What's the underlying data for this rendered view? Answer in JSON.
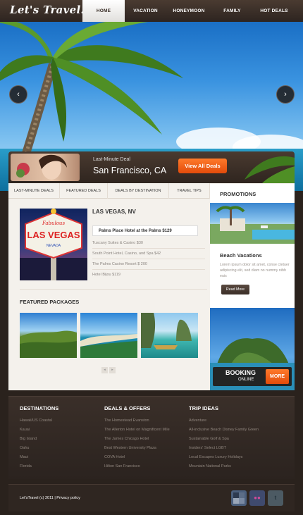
{
  "header": {
    "logo": "Let's Travel!",
    "nav": [
      {
        "label": "HOME",
        "active": true
      },
      {
        "label": "VACATION"
      },
      {
        "label": "HONEYMOON"
      },
      {
        "label": "FAMILY"
      },
      {
        "label": "HOT DEALS"
      }
    ]
  },
  "hero": {
    "prev_icon": "chevron-left-icon",
    "next_icon": "chevron-right-icon",
    "prev_glyph": "‹",
    "next_glyph": "›"
  },
  "deal": {
    "label": "Last-Minute Deal",
    "city": "San Francisco, CA",
    "button": "View All Deals"
  },
  "tabs": [
    "LAST-MINUTE DEALS",
    "FEATURED DEALS",
    "DEALS BY DESTINATION",
    "TRAVEL TIPS"
  ],
  "listing": {
    "title": "LAS VEGAS, NV",
    "highlight": "Palms Place Hotel at the Palms $129",
    "hotels": [
      "Tuscany Suites & Casino $30",
      "South Point Hotel, Casino, and Spa $42",
      "The Palms Casino Resort $ 200",
      "Hotel Bijou  $119"
    ],
    "sign_top": "Fabulous",
    "sign_main": "LAS VEGAS",
    "sign_bottom": "NEVADA"
  },
  "featured": {
    "title": "FEATURED PACKAGES",
    "prev": "◂",
    "next": "▸"
  },
  "promotions": {
    "title": "PROMOTIONS",
    "item_title": "Beach Vacations",
    "item_text": "Lorem ipsum dolor sit amet, conse ctetuer adipiscing elit, sed diam no nummy nibh euis",
    "button": "Read More"
  },
  "booking": {
    "title": "BOOKING",
    "subtitle": "ONLINE",
    "button": "MORE"
  },
  "footer": {
    "columns": [
      {
        "title": "DESTINATIONS",
        "links": [
          "Hawaii/US Coastal",
          "Kauai",
          "Big Island",
          "Oahu",
          "Maui",
          "Florida"
        ]
      },
      {
        "title": "DEALS & OFFERS",
        "links": [
          "The Homestead Evanston",
          "The Allerton Hotel on Magnificent Mile",
          "The James Chicago Hotel",
          "Best Western University Plaza",
          "COVA Hotel",
          "Hilton San Francisco"
        ]
      },
      {
        "title": "TRIP IDEAS",
        "links": [
          "Adventure",
          "All-inclusive Beach Disney Family Green",
          "Sustainable Golf & Spa",
          "Insiders' Select LGBT",
          "Local Escapes Luxury Holidays",
          "Mountain National Parks"
        ]
      }
    ],
    "copyright": "Let'sTravel (c) 2011 | Privacy policy",
    "social": [
      {
        "icon": "delicious-icon",
        "color": "#4b5f7d"
      },
      {
        "icon": "flickr-icon",
        "color": "#3f4a6e",
        "glyph": "●●"
      },
      {
        "icon": "twitter-icon",
        "color": "#4c5a63",
        "glyph": "t"
      }
    ]
  }
}
